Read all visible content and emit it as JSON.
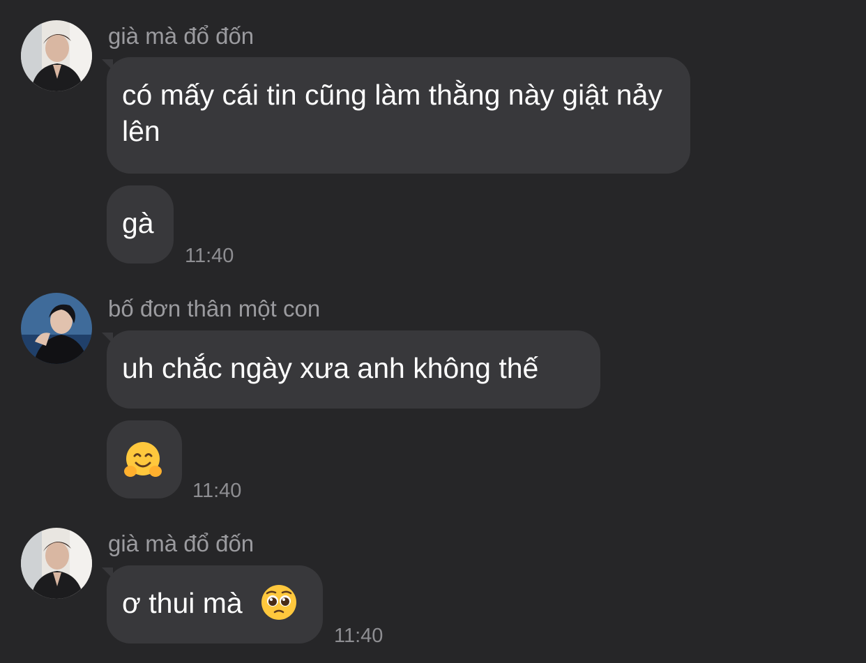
{
  "messages": [
    {
      "sender": "già mà đổ đốn",
      "avatar_icon": "user-avatar-photo-icon",
      "bubbles": [
        {
          "text": "có mấy cái tin cũng làm thằng này giật nảy lên"
        },
        {
          "text": "gà",
          "time": "11:40"
        }
      ]
    },
    {
      "sender": "bố đơn thân một con",
      "avatar_icon": "user-avatar-photo-icon",
      "bubbles": [
        {
          "text": "uh chắc ngày xưa anh không thế"
        },
        {
          "emoji": "hugging-face-emoji",
          "time": "11:40"
        }
      ]
    },
    {
      "sender": "già mà đổ đốn",
      "avatar_icon": "user-avatar-photo-icon",
      "bubbles": [
        {
          "text": "ơ thui mà",
          "emoji": "pleading-face-emoji",
          "time": "11:40"
        }
      ]
    }
  ],
  "colors": {
    "background": "#262628",
    "bubble": "#38383b",
    "sender_text": "#9b9b9f",
    "time_text": "#8e8e92",
    "message_text": "#ffffff"
  }
}
